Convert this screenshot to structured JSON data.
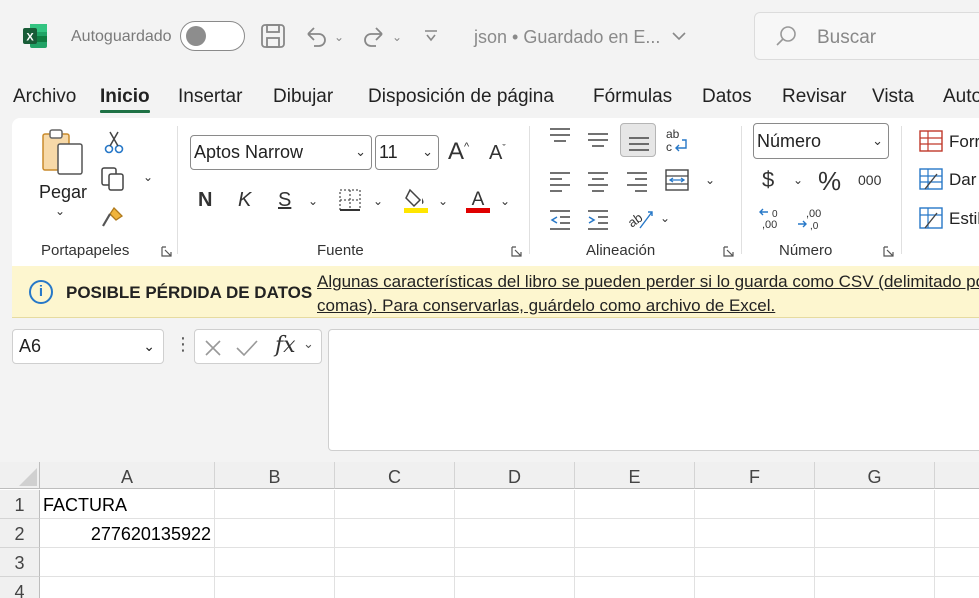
{
  "titlebar": {
    "autosave_label": "Autoguardado",
    "doc_title": "json  • Guardado en E...",
    "search_placeholder": "Buscar"
  },
  "tabs": [
    "Archivo",
    "Inicio",
    "Insertar",
    "Dibujar",
    "Disposición de página",
    "Fórmulas",
    "Datos",
    "Revisar",
    "Vista",
    "Auto"
  ],
  "ribbon": {
    "clipboard": {
      "paste_label": "Pegar",
      "group_label": "Portapapeles"
    },
    "font": {
      "font_name": "Aptos Narrow",
      "font_size": "11",
      "bold": "N",
      "italic": "K",
      "underline": "S",
      "group_label": "Fuente"
    },
    "alignment": {
      "group_label": "Alineación"
    },
    "number": {
      "format": "Número",
      "currency": "$",
      "percent": "%",
      "thousands": "000",
      "group_label": "Número"
    },
    "styles": {
      "item1": "Forr",
      "item2": "Dar",
      "item3": "Estil"
    }
  },
  "warning": {
    "title": "POSIBLE PÉRDIDA DE DATOS",
    "message": "Algunas características del libro se pueden perder si lo guarda como CSV (delimitado por comas). Para conservarlas, guárdelo como archivo de Excel."
  },
  "formula_bar": {
    "name_box": "A6",
    "formula": ""
  },
  "grid": {
    "columns": [
      "A",
      "B",
      "C",
      "D",
      "E",
      "F",
      "G"
    ],
    "rows": [
      "1",
      "2",
      "3",
      "4"
    ],
    "cells": {
      "A1": "FACTURA",
      "A2": "277620135922"
    }
  },
  "colors": {
    "accent": "#1e7145",
    "warning_bg": "#fdf6cf",
    "info": "#2778c8"
  }
}
